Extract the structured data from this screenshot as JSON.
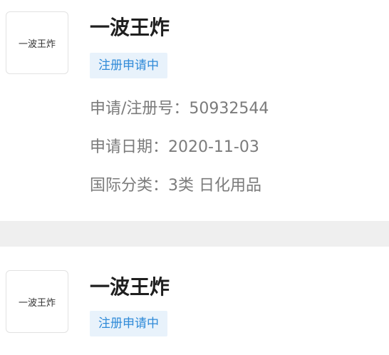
{
  "listing_1": {
    "logo_text": "一波王炸",
    "title": "一波王炸",
    "status": "注册申请中",
    "registration_number": "申请/注册号：50932544",
    "application_date": "申请日期：2020-11-03",
    "classification": "国际分类：3类 日化用品"
  },
  "listing_2": {
    "logo_text": "一波王炸",
    "title": "一波王炸",
    "status": "注册申请中"
  },
  "colors": {
    "title": "#1f1f1f",
    "info_text": "#7b7b7b",
    "badge_text": "#2f8ad8",
    "badge_bg": "#e8f2fb",
    "divider": "#efefef"
  }
}
